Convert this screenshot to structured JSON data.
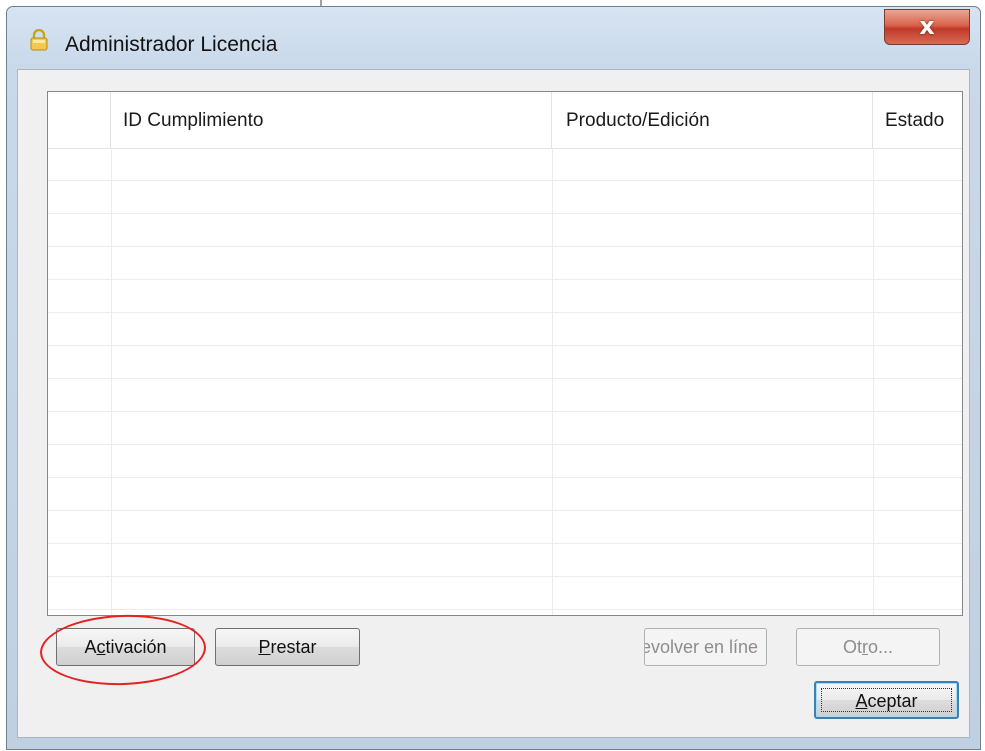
{
  "window": {
    "title": "Administrador Licencia",
    "close_label": "x",
    "app_icon": "lock-icon"
  },
  "listview": {
    "columns": [
      "",
      "ID Cumplimiento",
      "Producto/Edición",
      "Estado"
    ],
    "row_count": 14
  },
  "buttons": {
    "activacion_prefix": "A",
    "activacion_mnemonic": "c",
    "activacion_rest": "tivación",
    "prestar_mnemonic": "P",
    "prestar_rest": "restar",
    "devolver": "evolver en líne",
    "otro_prefix": "Ot",
    "otro_mnemonic": "r",
    "otro_rest": "o...",
    "aceptar_mnemonic": "A",
    "aceptar_rest": "ceptar"
  },
  "colors": {
    "annotation": "#e32222",
    "close_button": "#c0392b"
  }
}
